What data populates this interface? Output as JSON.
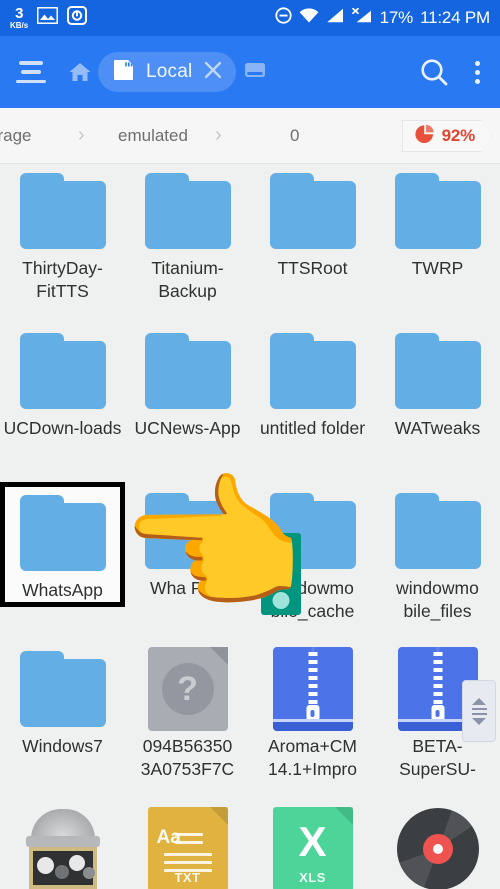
{
  "statusbar": {
    "network_speed_value": "3",
    "network_speed_unit": "KB/s",
    "icons": [
      "image-icon",
      "disk-icon",
      "do-not-disturb-icon",
      "wifi-icon",
      "signal-icon",
      "signal-no-sim-icon"
    ],
    "battery": "17%",
    "clock": "11:24 PM"
  },
  "toolbar": {
    "menu_label": "menu",
    "home_label": "home",
    "tab_label": "Local",
    "close_tab_label": "✕",
    "search_label": "search",
    "overflow_label": "more options",
    "background_color": "#2979f2"
  },
  "breadcrumb": {
    "items": [
      "orage",
      "emulated",
      "0"
    ],
    "separator": "›",
    "usage_percent": "92%",
    "usage_color": "#e2452f"
  },
  "grid": {
    "items": [
      {
        "name": "ThirtyDay-FitTTS",
        "type": "folder",
        "selected": false
      },
      {
        "name": "Titanium-Backup",
        "type": "folder",
        "selected": false
      },
      {
        "name": "TTSRoot",
        "type": "folder",
        "selected": false
      },
      {
        "name": "TWRP",
        "type": "folder",
        "selected": false
      },
      {
        "name": "UCDown-loads",
        "type": "folder",
        "selected": false
      },
      {
        "name": "UCNews-App",
        "type": "folder",
        "selected": false
      },
      {
        "name": "untitled folder",
        "type": "folder",
        "selected": false
      },
      {
        "name": "WATweaks",
        "type": "folder",
        "selected": false
      },
      {
        "name": "WhatsApp",
        "type": "folder",
        "selected": true
      },
      {
        "name": "Wha Plus",
        "type": "folder",
        "selected": false
      },
      {
        "name": "windowmo bile_cache",
        "type": "folder",
        "selected": false
      },
      {
        "name": "windowmo bile_files",
        "type": "folder",
        "selected": false
      },
      {
        "name": "Windows7",
        "type": "folder",
        "selected": false
      },
      {
        "name": "094B56350 3A0753F7C",
        "type": "unknown-file",
        "selected": false
      },
      {
        "name": "Aroma+CM 14.1+Impro",
        "type": "zip",
        "selected": false
      },
      {
        "name": "BETA- SuperSU-",
        "type": "zip",
        "selected": false
      },
      {
        "name": "",
        "type": "gearbox",
        "selected": false
      },
      {
        "name": "",
        "type": "txt",
        "tag": "TXT",
        "selected": false
      },
      {
        "name": "",
        "type": "xls",
        "tag": "XLS",
        "selected": false
      },
      {
        "name": "",
        "type": "disc",
        "selected": false
      }
    ],
    "folder_color": "#62aee5",
    "txt_color": "#e0b341",
    "xls_color": "#4dd599",
    "zip_color": "#4d73e8"
  },
  "overlay": {
    "pointer_icon": "👈",
    "touch_indicator_color": "#00957f"
  },
  "fastscroll": {
    "label": "fast-scroll-handle"
  }
}
